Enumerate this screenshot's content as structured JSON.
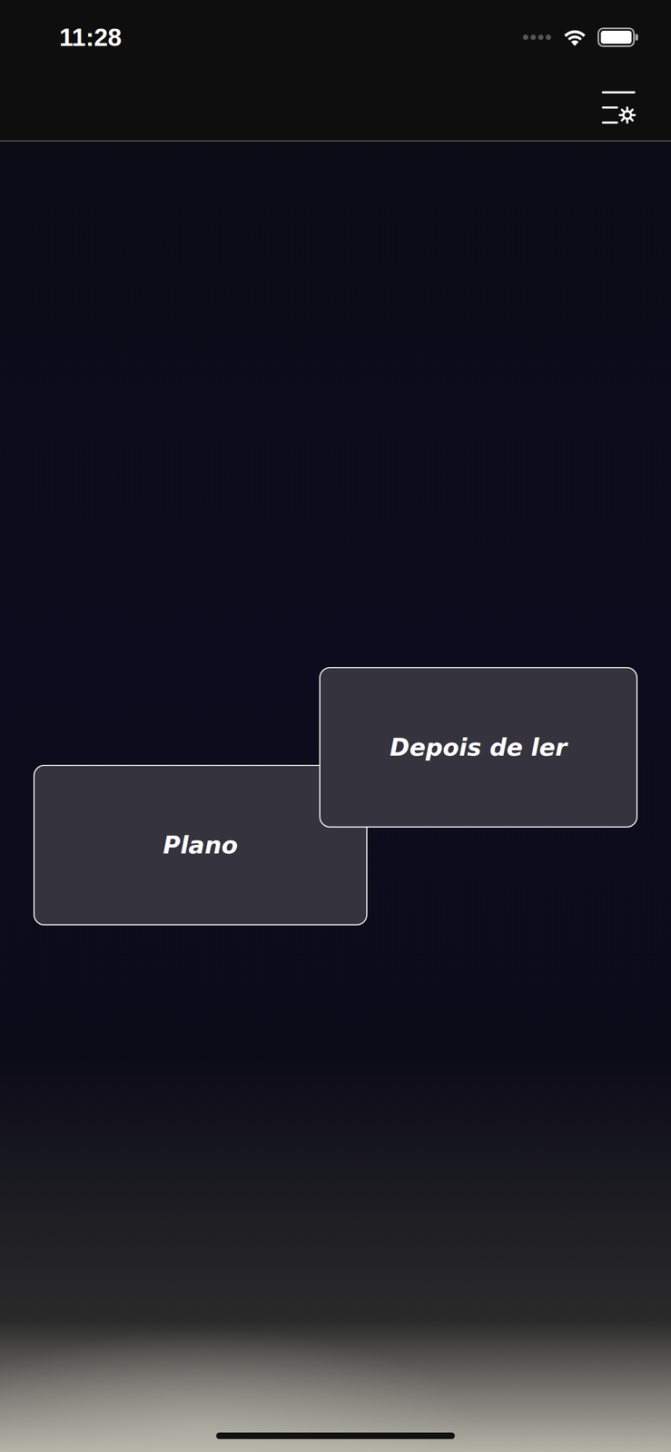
{
  "status_bar": {
    "time": "11:28"
  },
  "buttons": [
    {
      "label": "Depois de ler"
    },
    {
      "label": "Plano"
    }
  ]
}
